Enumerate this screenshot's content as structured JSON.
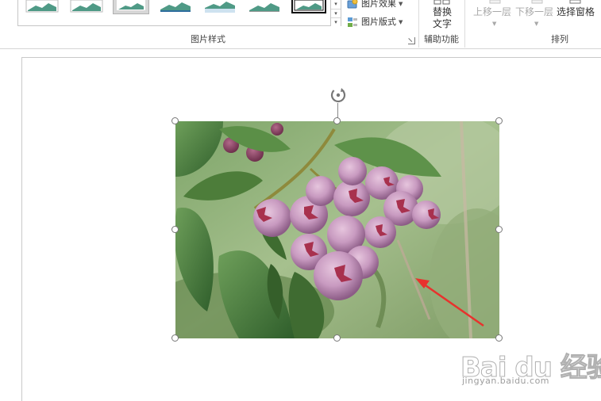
{
  "ribbon": {
    "picture_styles": {
      "group_label": "图片样式",
      "picture_effects_label": "图片效果",
      "picture_layout_label": "图片版式"
    },
    "accessibility": {
      "group_label": "辅助功能",
      "alt_text_line1": "替换",
      "alt_text_line2": "文字"
    },
    "arrange": {
      "group_label": "排列",
      "bring_forward": "上移一层",
      "send_backward": "下移一层",
      "selection_pane": "选择窗格"
    }
  },
  "watermark": {
    "logo_text": "Bai du 经验",
    "url": "jingyan.baidu.com"
  },
  "icons": {
    "rotate": "rotate-handle-icon",
    "effects": "picture-effects-icon",
    "layout": "picture-layout-icon",
    "dialog_launcher": "dialog-launcher-icon"
  },
  "colors": {
    "ribbon_border": "#d5d5d5",
    "annotation_arrow": "#e8322d",
    "handle_border": "#777777"
  }
}
